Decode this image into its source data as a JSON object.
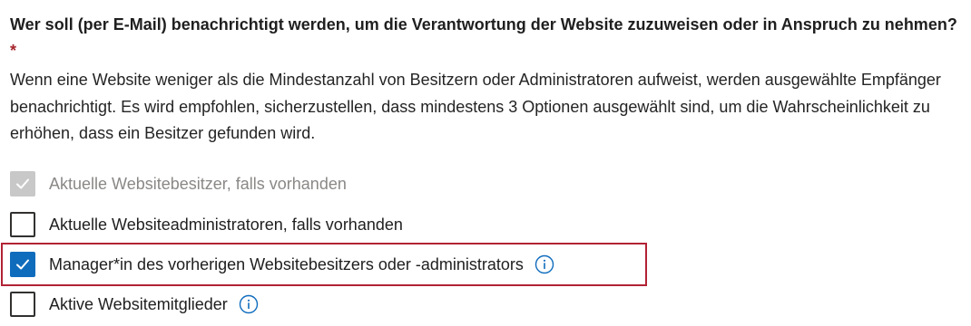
{
  "question": {
    "text": "Wer soll (per E-Mail) benachrichtigt werden, um die Verantwortung der Website zuzuweisen oder in Anspruch zu nehmen?",
    "required_marker": "*"
  },
  "description": "Wenn eine Website weniger als die Mindestanzahl von Besitzern oder Administratoren aufweist, werden ausgewählte Empfänger benachrichtigt. Es wird empfohlen, sicherzustellen, dass mindestens 3 Optionen ausgewählt sind, um die Wahrscheinlichkeit zu erhöhen, dass ein Besitzer gefunden wird.",
  "options": [
    {
      "label": "Aktuelle Websitebesitzer, falls vorhanden",
      "checked": true,
      "disabled": true,
      "has_info": false
    },
    {
      "label": "Aktuelle Websiteadministratoren, falls vorhanden",
      "checked": false,
      "disabled": false,
      "has_info": false
    },
    {
      "label": "Manager*in des vorherigen Websitebesitzers oder -administrators",
      "checked": true,
      "disabled": false,
      "has_info": true,
      "highlighted": true
    },
    {
      "label": "Aktive Websitemitglieder",
      "checked": false,
      "disabled": false,
      "has_info": true
    }
  ],
  "colors": {
    "accent": "#0f6cbd",
    "highlight_border": "#b22234",
    "required": "#a4262c",
    "disabled_text": "#8a8886"
  },
  "icons": {
    "check": "checkmark-icon",
    "info": "info-icon"
  }
}
